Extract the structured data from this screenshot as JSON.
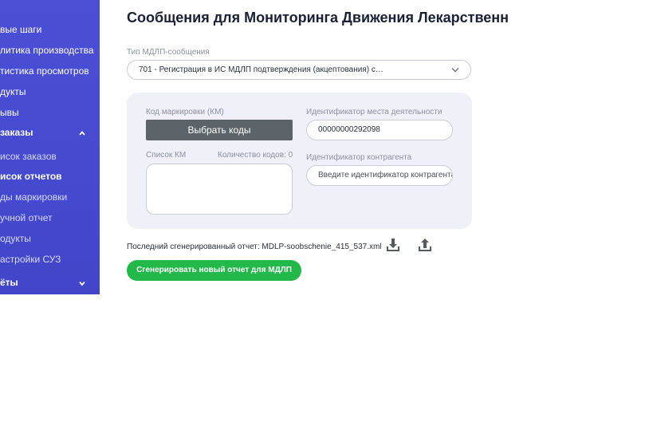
{
  "sidebar": {
    "items": [
      {
        "label": "вые шаги",
        "type": "item"
      },
      {
        "label": "литика производства",
        "type": "item"
      },
      {
        "label": "тистика просмотров",
        "type": "item"
      },
      {
        "label": "дукты",
        "type": "item"
      },
      {
        "label": "ывы",
        "type": "item"
      },
      {
        "label": "заказы",
        "type": "section-open"
      },
      {
        "label": "исок заказов",
        "type": "sub"
      },
      {
        "label": "исок отчетов",
        "type": "sub-active"
      },
      {
        "label": "ды маркировки",
        "type": "sub"
      },
      {
        "label": "учной отчет",
        "type": "sub"
      },
      {
        "label": "одукты",
        "type": "sub"
      },
      {
        "label": "астройки СУЗ",
        "type": "sub"
      },
      {
        "label": "ёты",
        "type": "section-closed"
      }
    ]
  },
  "page": {
    "title": "Сообщения для Мониторинга Движения Лекарственн"
  },
  "message_type": {
    "label": "Тип МДЛП-сообщения",
    "value": "701 - Регистрация в ИС МДЛП подтверждения (акцептования) с…"
  },
  "km": {
    "label": "Код маркировки (КМ)",
    "select_button": "Выбрать коды",
    "list_label": "Список КМ",
    "count_label": "Количество кодов: 0"
  },
  "activity_place": {
    "label": "Идентификатор места деятельности",
    "value": "00000000292098"
  },
  "counterparty": {
    "label": "Идентификатор контрагента",
    "placeholder": "Введите идентификатор контрагента"
  },
  "report": {
    "last_report_text": "Последний сгенерированный отчет: MDLP-soobschenie_415_537.xml",
    "generate_button": "Сгенерировать новый отчет для МДЛП"
  },
  "colors": {
    "sidebar": "#4b4fd6",
    "primary_green": "#22b84a",
    "dark_button": "#5d6469",
    "panel_bg": "#eff0f8"
  },
  "icons": {
    "download": "download-icon",
    "upload": "upload-icon",
    "chevron": "chevron-down-icon"
  }
}
